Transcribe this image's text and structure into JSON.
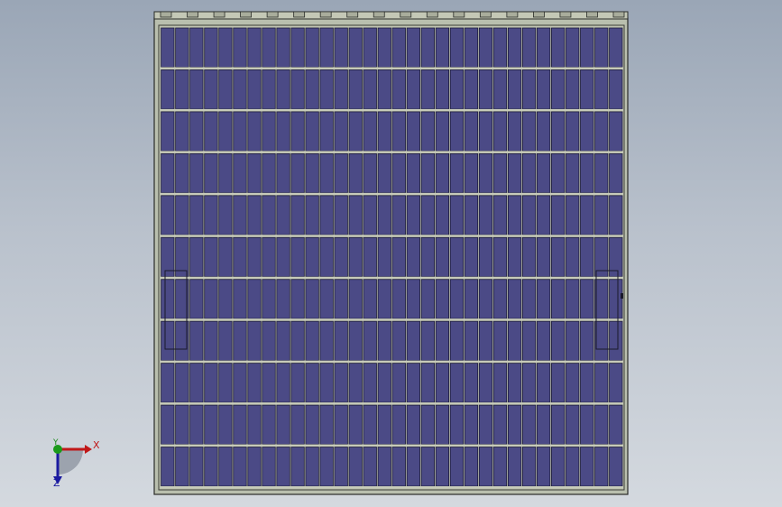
{
  "viewport": {
    "background_top": "#9aa6b6",
    "background_bottom": "#d4d9df"
  },
  "model": {
    "name": "solar-panel-array-front-view",
    "frame_color": "#b9bfae",
    "frame_edge_color": "#2a2c28",
    "cell_color": "#4b4a86",
    "cell_edge_color": "#1c1b3a",
    "grid_rows": 11,
    "grid_columns": 32
  },
  "triad": {
    "x_label": "X",
    "y_label": "Y",
    "z_label": "Z",
    "x_color": "#c01818",
    "y_color": "#1a8a1a",
    "z_color": "#1a1aa0"
  }
}
